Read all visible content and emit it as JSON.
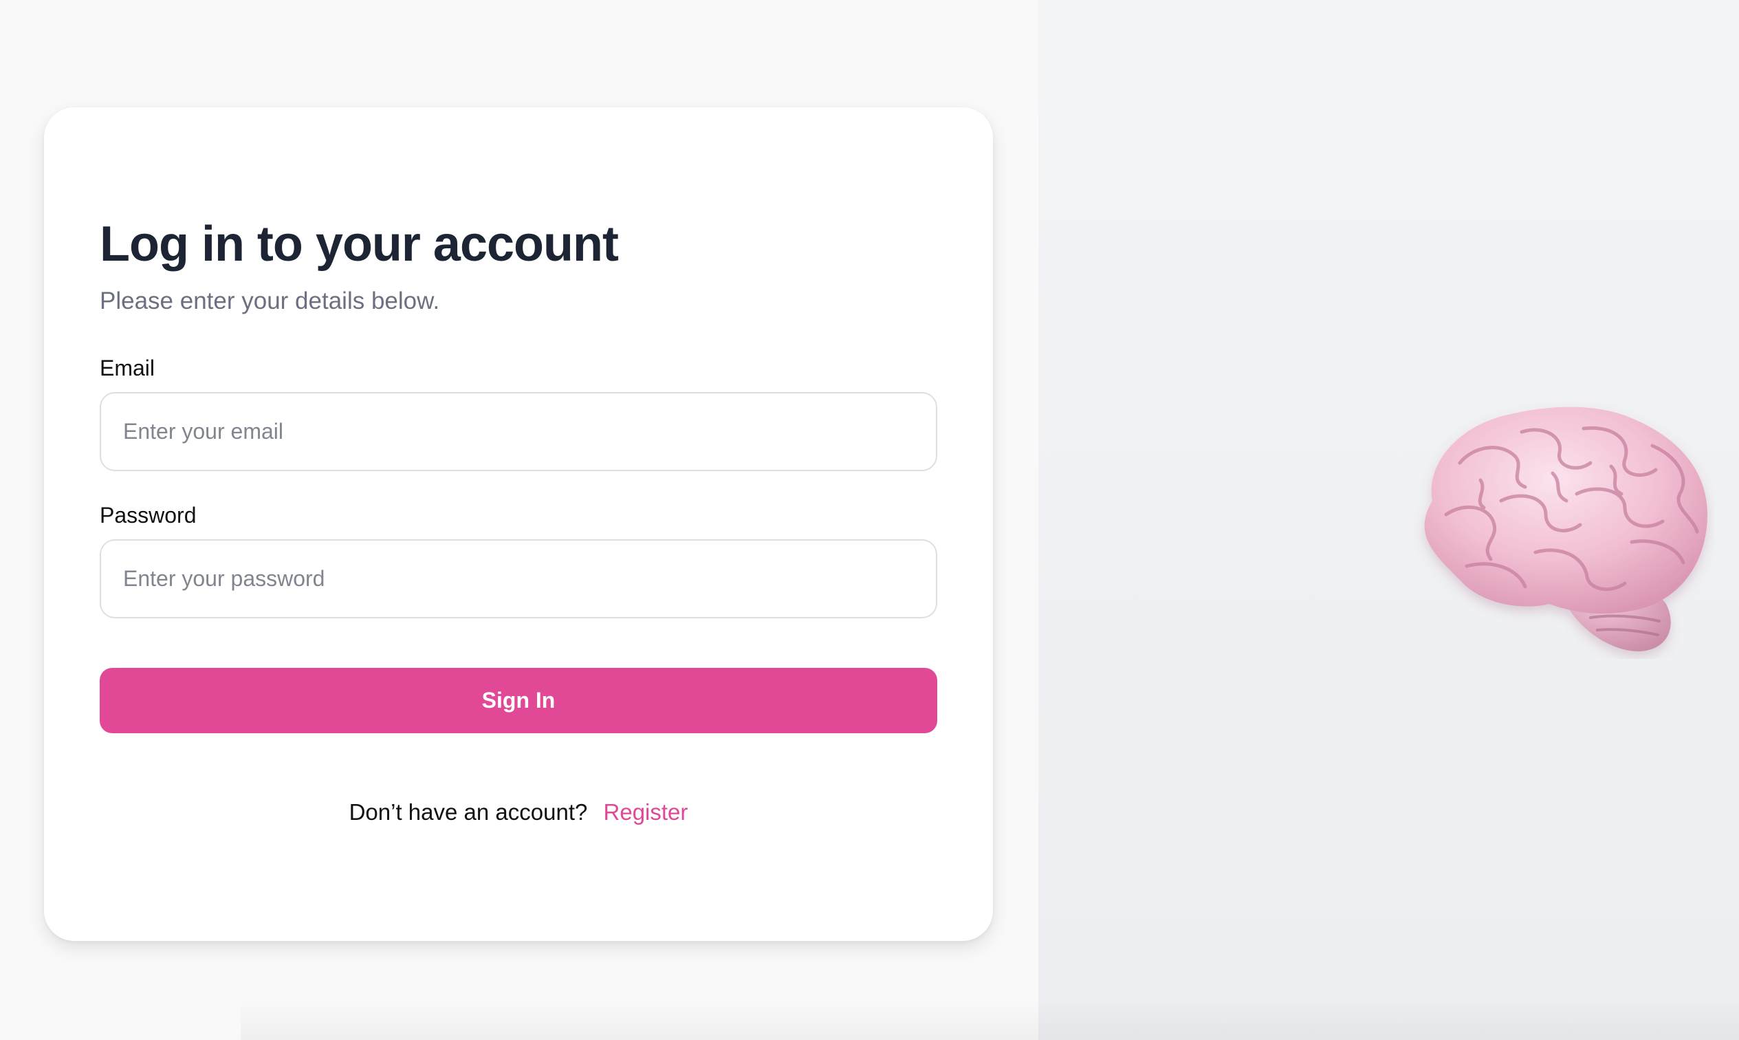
{
  "login": {
    "title": "Log in to your account",
    "subtitle": "Please enter your details below.",
    "email_label": "Email",
    "email_placeholder": "Enter your email",
    "email_value": "",
    "password_label": "Password",
    "password_placeholder": "Enter your password",
    "password_value": "",
    "signin_label": "Sign In",
    "register_prompt": "Don’t have an account?",
    "register_link": "Register"
  },
  "illustration": {
    "icon": "brain-icon"
  },
  "colors": {
    "accent": "#e14996",
    "heading": "#1d2433",
    "muted": "#6b7080",
    "left_background": "#f9f9fa",
    "right_background": "#eceef1"
  }
}
